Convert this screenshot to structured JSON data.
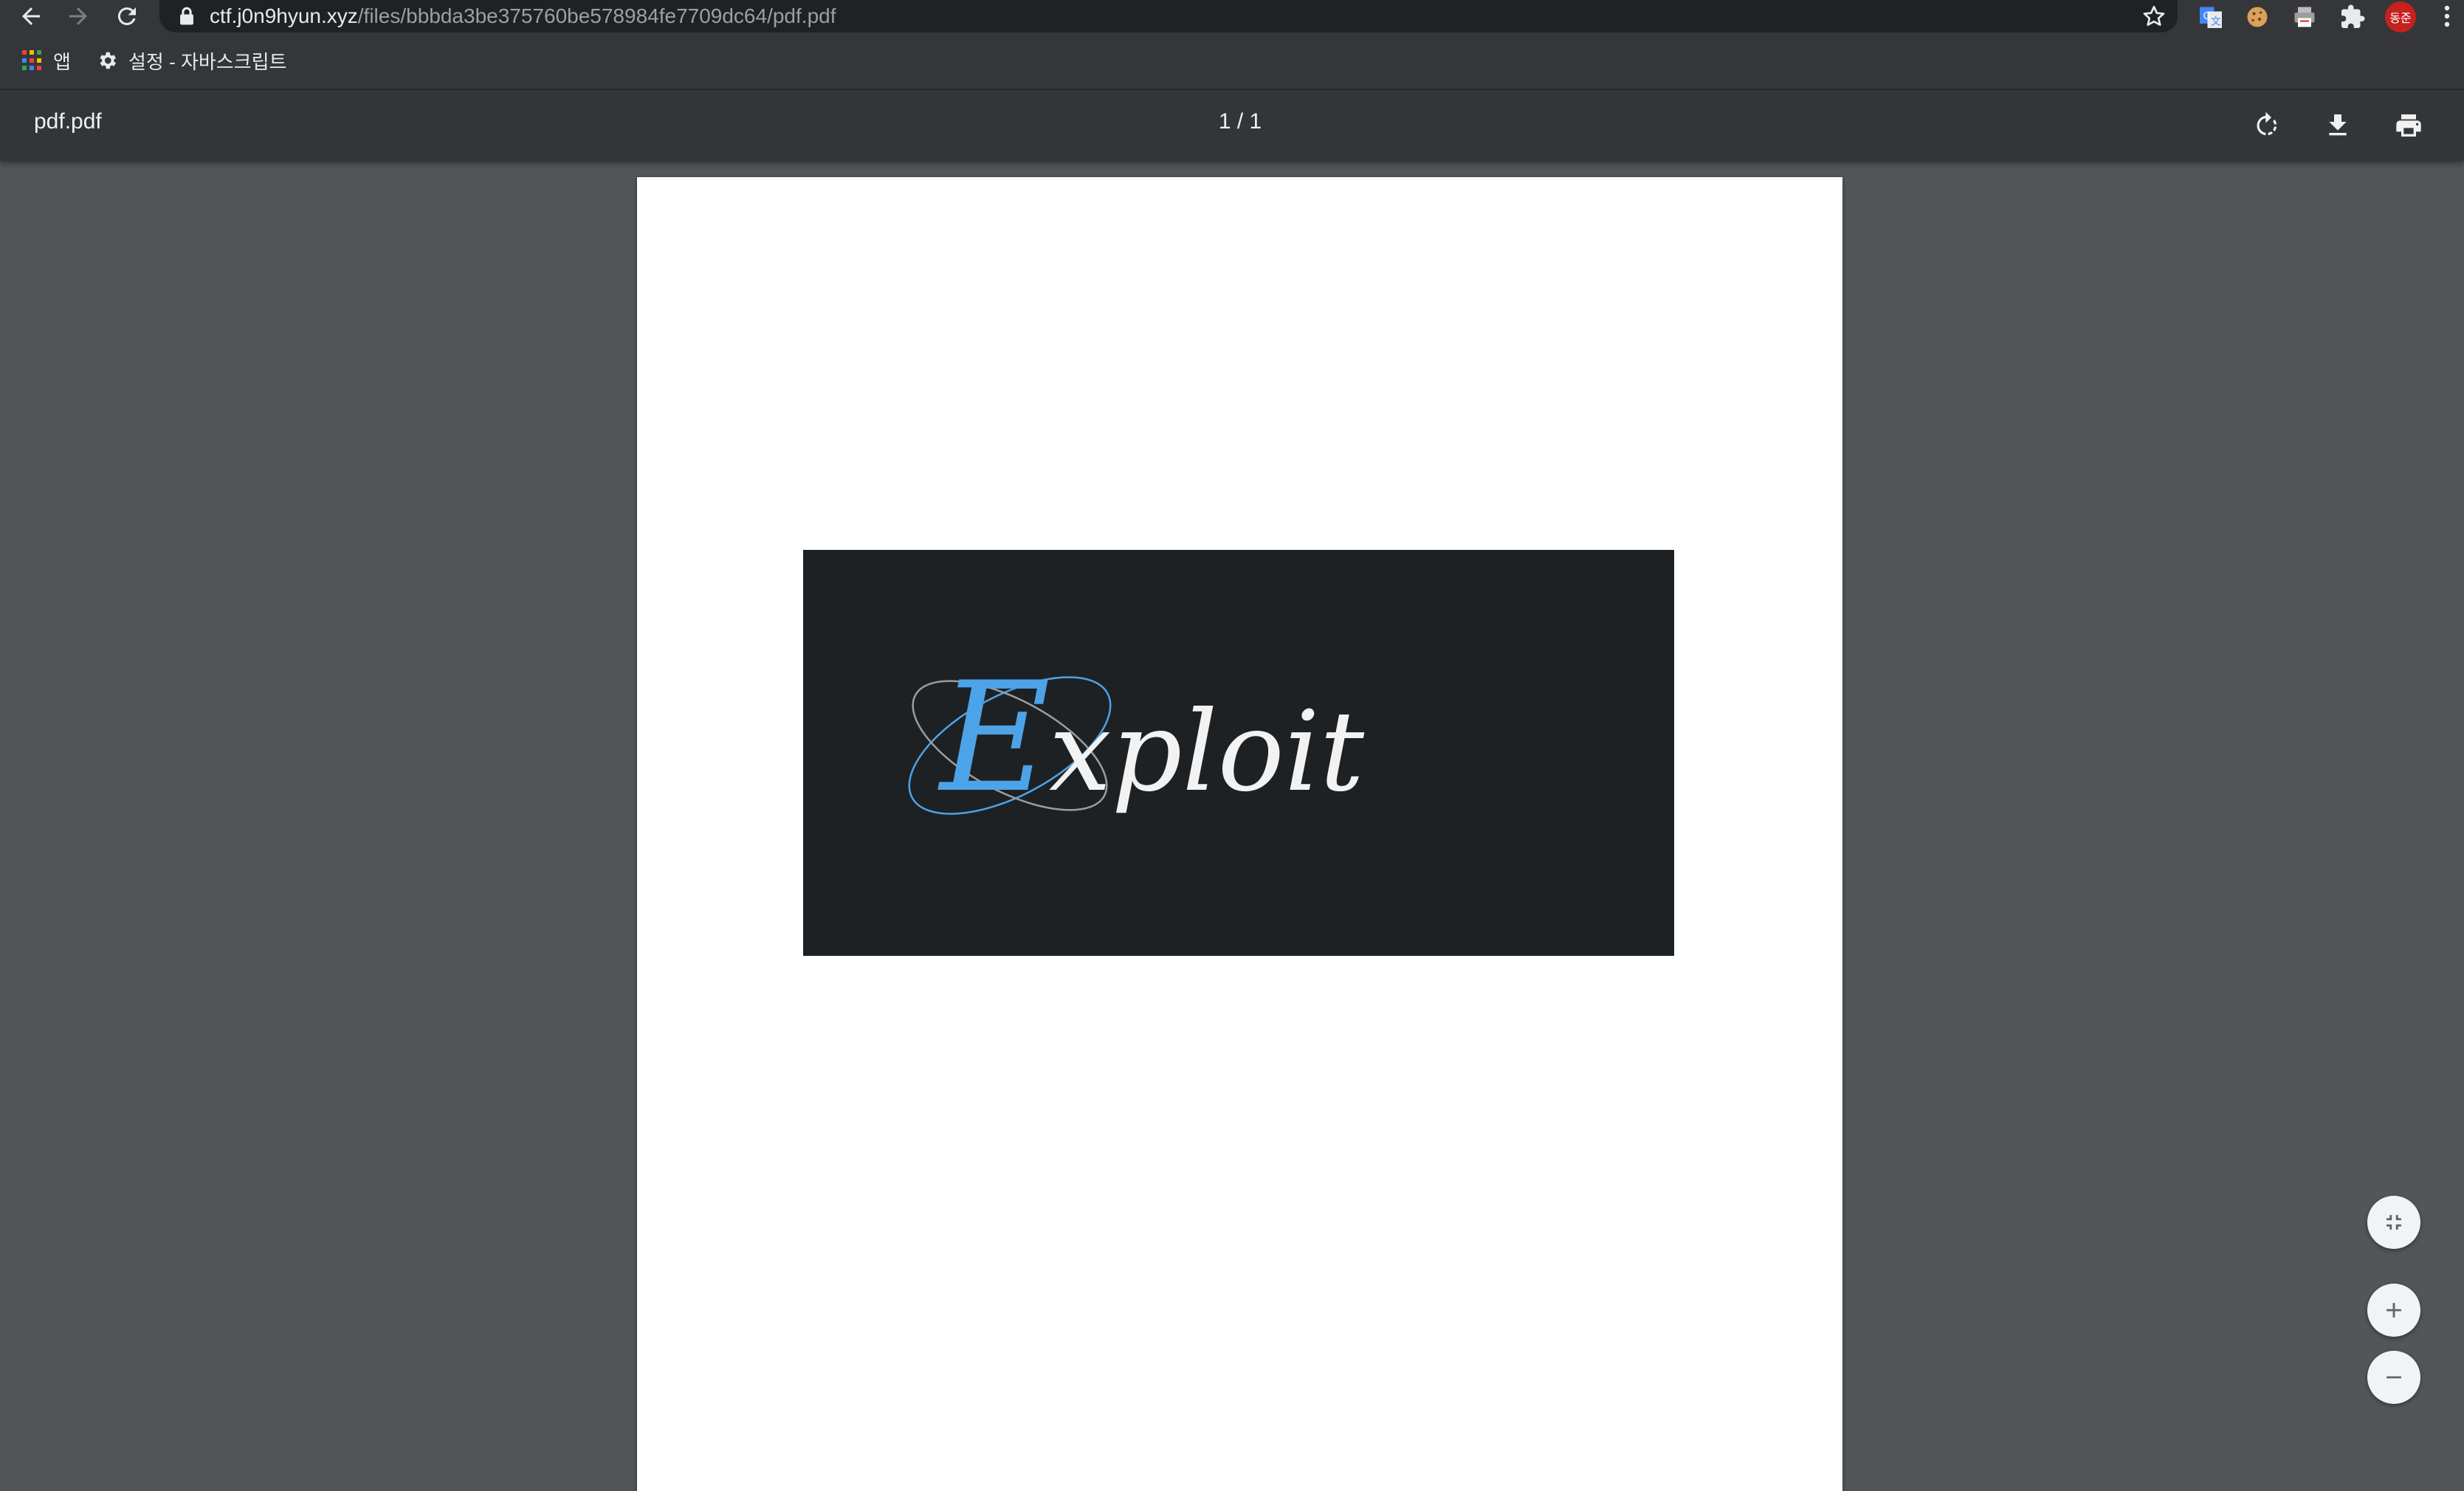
{
  "browser": {
    "url_host": "ctf.j0n9hyun.xyz",
    "url_path": "/files/bbbda3be375760be578984fe7709dc64/pdf.pdf",
    "avatar_text": "동준"
  },
  "bookmarks": {
    "apps_label": "앱",
    "settings_label": "설정 - 자바스크립트"
  },
  "pdf_viewer": {
    "file_name": "pdf.pdf",
    "page_indicator": "1 / 1"
  },
  "page_content": {
    "logo_text": "Exploit"
  },
  "icons": {
    "back": "back-arrow-icon",
    "forward": "forward-arrow-icon",
    "reload": "reload-icon",
    "lock": "lock-icon",
    "bookmark_star": "star-icon",
    "extensions": [
      "translate-icon",
      "cookie-icon",
      "printer-extension-icon",
      "puzzle-icon"
    ],
    "rotate": "rotate-icon",
    "download": "download-icon",
    "print": "print-icon",
    "fit": "fit-to-page-icon",
    "zoom_in": "plus-icon",
    "zoom_out": "minus-icon"
  },
  "colors": {
    "viewer_background": "#525659",
    "toolbar": "#323639",
    "logo_background": "#1e2124",
    "logo_accent": "#4da3e8"
  }
}
